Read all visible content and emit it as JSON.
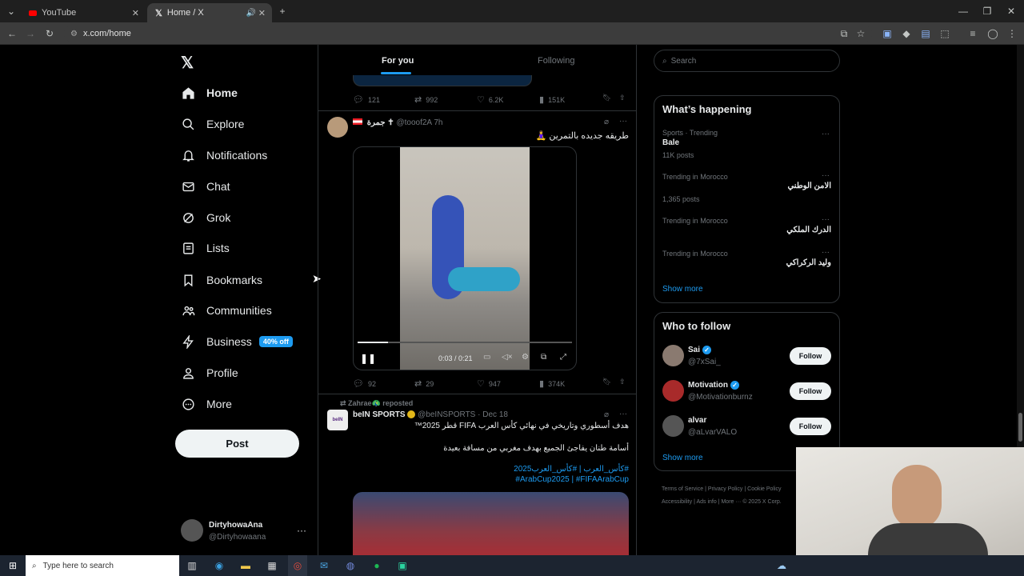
{
  "browser": {
    "tabs": [
      {
        "title": "YouTube",
        "active": false
      },
      {
        "title": "Home / X",
        "active": true
      }
    ],
    "url": "x.com/home"
  },
  "nav": {
    "items": [
      {
        "label": "Home",
        "icon": "home-icon"
      },
      {
        "label": "Explore",
        "icon": "search-icon"
      },
      {
        "label": "Notifications",
        "icon": "bell-icon"
      },
      {
        "label": "Chat",
        "icon": "mail-icon"
      },
      {
        "label": "Grok",
        "icon": "grok-icon"
      },
      {
        "label": "Lists",
        "icon": "list-icon"
      },
      {
        "label": "Bookmarks",
        "icon": "bookmark-icon"
      },
      {
        "label": "Communities",
        "icon": "people-icon"
      },
      {
        "label": "Business",
        "icon": "lightning-icon"
      },
      {
        "label": "Profile",
        "icon": "person-icon"
      },
      {
        "label": "More",
        "icon": "more-circle-icon"
      }
    ],
    "business_badge": "40% off",
    "post_label": "Post",
    "account": {
      "name": "DirtyhowaAna",
      "handle": "@Dirtyhowaana"
    }
  },
  "feed": {
    "tabs": [
      {
        "label": "For you"
      },
      {
        "label": "Following"
      }
    ],
    "top_actions": {
      "replies": "121",
      "reposts": "992",
      "likes": "6.2K",
      "views": "151K"
    },
    "tweet1": {
      "name": "جمرة ✝",
      "handle": "@tooof2A",
      "time": "7h",
      "text": "طريقه جديده بالتمرين 🧘‍♀️",
      "video_time": "0:03 / 0:21",
      "video_progress": 0.14,
      "actions": {
        "replies": "92",
        "reposts": "29",
        "likes": "947",
        "views": "374K"
      }
    },
    "tweet2": {
      "reposted_by": "Zahrae🦚 reposted",
      "name": "beIN SPORTS",
      "handle": "@beINSPORTS",
      "time": "Dec 18",
      "line1": "هدف أسطوري وتاريخي في نهائي كأس العرب FIFA قطر 2025™",
      "line2": "أسامة طنان يفاجئ الجميع بهدف مغربي من مسافة بعيدة",
      "hashtags1": "#كأس_العرب | #كأس_العرب2025",
      "hashtags2": "#ArabCup2025 | #FIFAArabCup"
    }
  },
  "sidebar": {
    "search_placeholder": "Search",
    "happening_title": "What’s happening",
    "trends": [
      {
        "meta": "Sports · Trending",
        "title": "Bale",
        "posts": "11K posts"
      },
      {
        "meta": "Trending in Morocco",
        "title": "الامن الوطني",
        "posts": "1,365 posts"
      },
      {
        "meta": "Trending in Morocco",
        "title": "الدرك الملكي",
        "posts": ""
      },
      {
        "meta": "Trending in Morocco",
        "title": "وليد الركراكي",
        "posts": ""
      }
    ],
    "show_more": "Show more",
    "follow_title": "Who to follow",
    "follow": [
      {
        "name": "Sai",
        "handle": "@7xSai_",
        "verified": true
      },
      {
        "name": "Motivation",
        "handle": "@Motivationburnz",
        "verified": true
      },
      {
        "name": "alvar",
        "handle": "@aLvarVALO",
        "verified": false
      }
    ],
    "follow_label": "Follow",
    "follow_show_more": "Show more",
    "footer": [
      "Terms of Service",
      "Privacy Policy",
      "Cookie Policy",
      "Accessibility",
      "Ads info",
      "More ···",
      "© 2025 X Corp."
    ]
  },
  "taskbar": {
    "search_placeholder": "Type here to search"
  },
  "colors": {
    "accent": "#1d9bf0",
    "bg": "#000000",
    "border": "#2f3336",
    "muted": "#71767b"
  }
}
